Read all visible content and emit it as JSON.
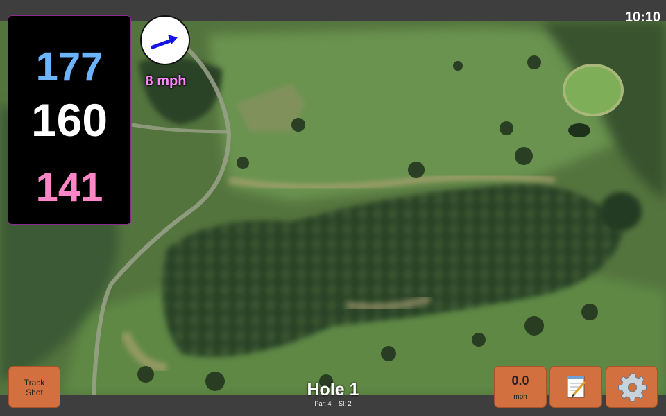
{
  "status": {
    "time": "10:10"
  },
  "distances": {
    "back": "177",
    "middle": "160",
    "front": "141"
  },
  "wind": {
    "speed": "8 mph",
    "direction_icon": "arrow-right-icon",
    "arrow_color": "#1414e6"
  },
  "buttons": {
    "track_shot": {
      "line1": "Track",
      "line2": "Shot"
    },
    "speed": {
      "value": "0.0",
      "unit": "mph"
    },
    "notes_icon": "notepad-icon",
    "settings_icon": "gear-icon"
  },
  "hole": {
    "title": "Hole 1",
    "par": "Par: 4",
    "si": "SI: 2"
  },
  "colors": {
    "back": "#6cb4ff",
    "middle": "#ffffff",
    "front": "#ff86c6",
    "button": "#d2703f",
    "accent": "#b030b0"
  }
}
